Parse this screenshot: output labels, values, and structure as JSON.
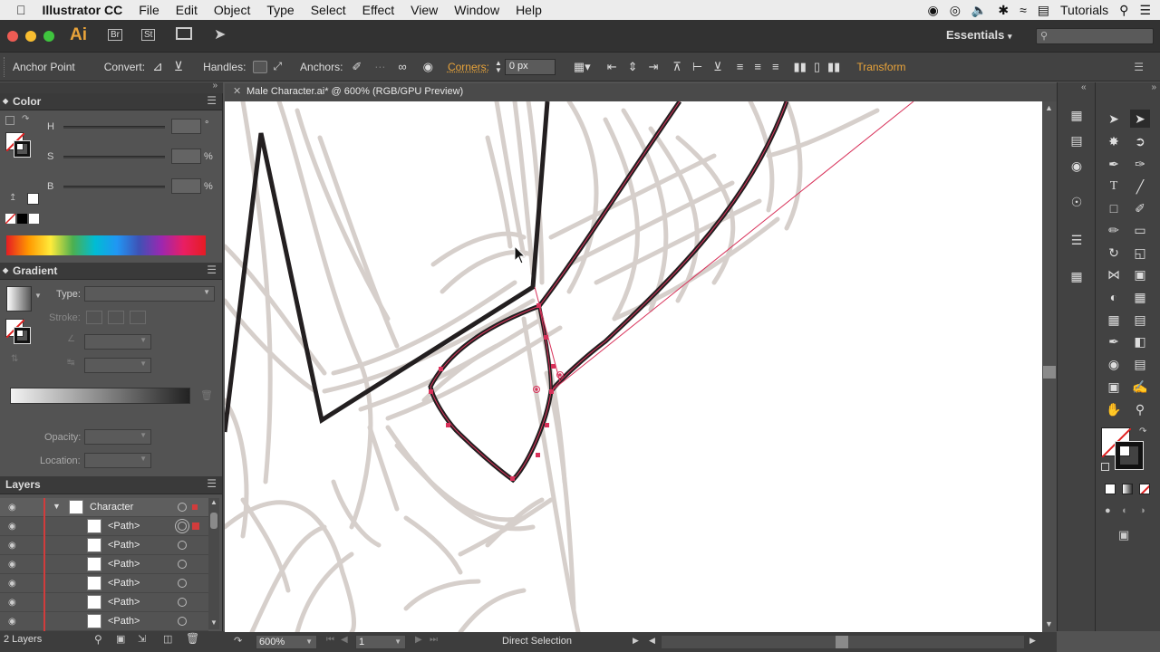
{
  "menubar": {
    "app_name": "Illustrator CC",
    "items": [
      "File",
      "Edit",
      "Object",
      "Type",
      "Select",
      "Effect",
      "View",
      "Window",
      "Help"
    ],
    "right_label": "Tutorials"
  },
  "appbar": {
    "logo": "Ai",
    "bridge": "Br",
    "stock": "St",
    "workspace": "Essentials"
  },
  "control_bar": {
    "anchor_point": "Anchor Point",
    "convert": "Convert:",
    "handles": "Handles:",
    "anchors": "Anchors:",
    "corners": "Corners:",
    "corners_value": "0 px",
    "transform": "Transform"
  },
  "color_panel": {
    "title": "Color",
    "h_label": "H",
    "s_label": "S",
    "b_label": "B",
    "h_unit": "°",
    "s_unit": "%",
    "b_unit": "%"
  },
  "gradient_panel": {
    "title": "Gradient",
    "type_label": "Type:",
    "stroke_label": "Stroke:",
    "opacity_label": "Opacity:",
    "location_label": "Location:"
  },
  "layers_panel": {
    "title": "Layers",
    "parent_layer": "Character",
    "rows": [
      "<Path>",
      "<Path>",
      "<Path>",
      "<Path>",
      "<Path>",
      "<Path>"
    ],
    "footer_count": "2 Layers"
  },
  "document": {
    "tab_title": "Male Character.ai* @ 600% (RGB/GPU Preview)",
    "zoom": "600%",
    "artboard": "1",
    "status_tool": "Direct Selection"
  },
  "colors": {
    "accent": "#e8a33a",
    "selection_red": "#d8325a",
    "sketch_gray": "#d6cfcb"
  }
}
